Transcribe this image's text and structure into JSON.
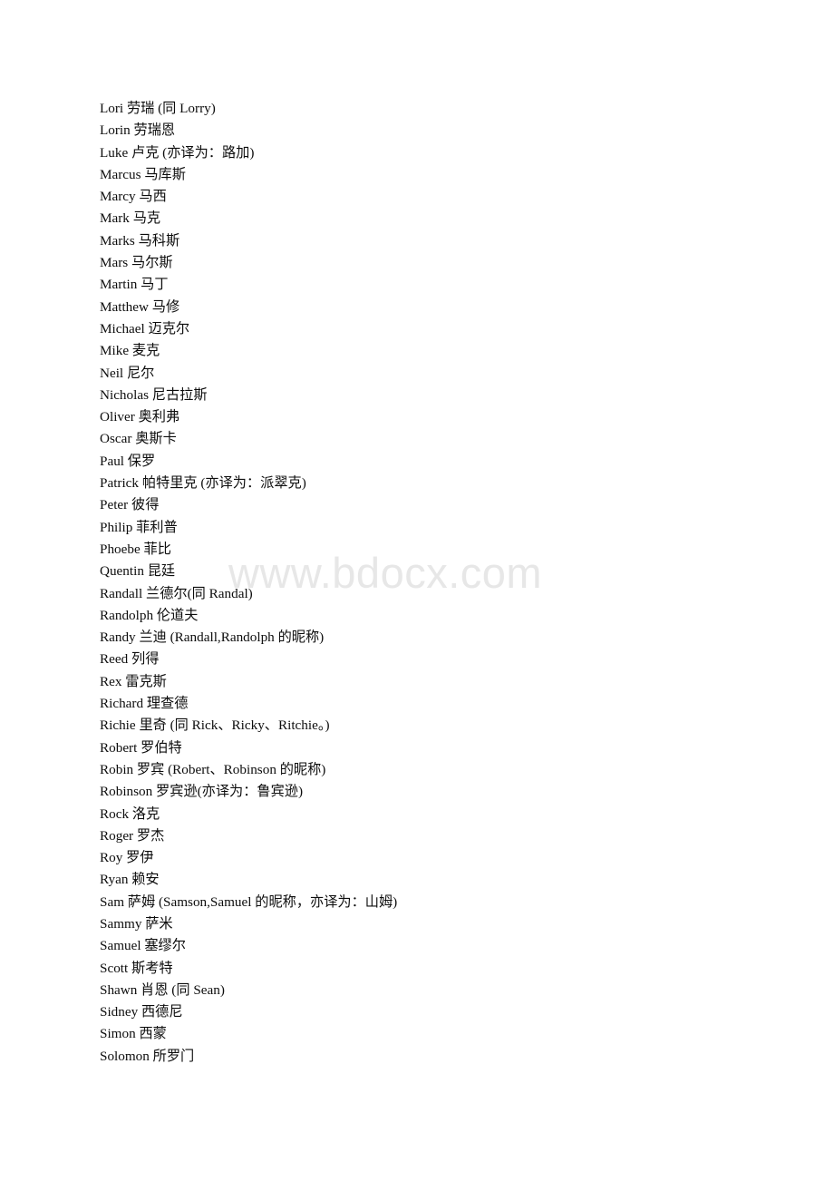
{
  "document": {
    "type": "name-glossary-page",
    "background_color": "#ffffff",
    "text_color": "#0d0d0d",
    "watermark": {
      "text": "www.bdocx.com",
      "color": "#e7e7e7"
    },
    "lines": [
      "Lori 劳瑞 (同 Lorry)",
      "Lorin 劳瑞恩",
      "Luke 卢克 (亦译为：路加)",
      "Marcus 马库斯",
      "Marcy 马西",
      "Mark 马克",
      "Marks 马科斯",
      "Mars 马尔斯",
      "Martin 马丁",
      "Matthew 马修",
      "Michael 迈克尔",
      "Mike 麦克",
      "Neil 尼尔",
      "Nicholas 尼古拉斯",
      "Oliver 奥利弗",
      "Oscar 奥斯卡",
      "Paul 保罗",
      "Patrick 帕特里克 (亦译为：派翠克)",
      "Peter 彼得",
      "Philip 菲利普",
      "Phoebe 菲比",
      "Quentin 昆廷",
      "Randall 兰德尔(同 Randal)",
      "Randolph 伦道夫",
      "Randy 兰迪 (Randall,Randolph 的昵称)",
      "Reed 列得",
      "Rex 雷克斯",
      "Richard 理查德",
      "Richie 里奇 (同 Rick、Ricky、Ritchie。)",
      "Robert 罗伯特",
      "Robin 罗宾 (Robert、Robinson 的昵称)",
      "Robinson 罗宾逊(亦译为：鲁宾逊)",
      "Rock 洛克",
      "Roger 罗杰",
      "Roy 罗伊",
      "Ryan 赖安",
      "Sam 萨姆 (Samson,Samuel 的昵称，亦译为：山姆)",
      "Sammy 萨米",
      "Samuel 塞缪尔",
      "Scott 斯考特",
      "Shawn 肖恩 (同 Sean)",
      "Sidney 西德尼",
      "Simon 西蒙",
      "Solomon 所罗门"
    ]
  }
}
